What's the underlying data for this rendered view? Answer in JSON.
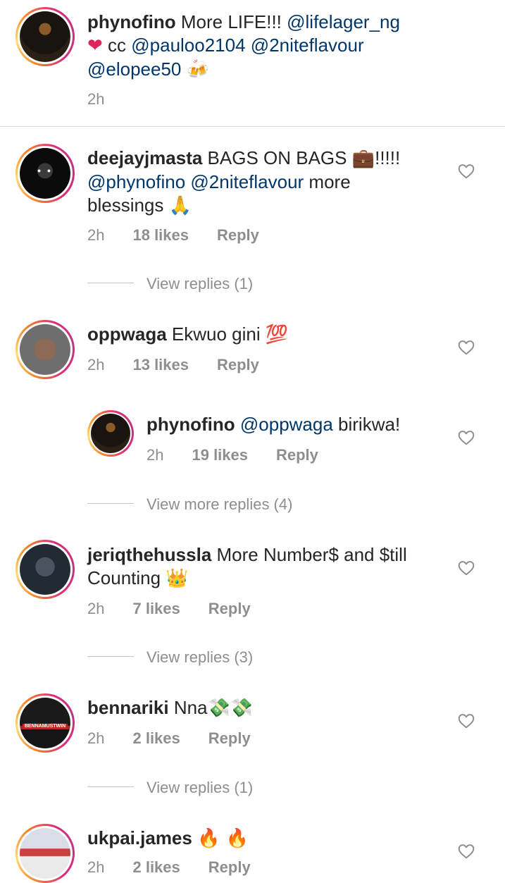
{
  "caption": {
    "username": "phynofino",
    "pre": " More LIFE!!! ",
    "m1": "@lifelager_ng",
    "heart": "❤",
    "cc": " cc ",
    "m2": "@pauloo2104",
    "m3": "@2niteflavour",
    "m4": "@elopee50",
    "emoji": "🍻",
    "time": "2h"
  },
  "comments": [
    {
      "username": "deejayjmasta",
      "text1": " BAGS ON BAGS ",
      "emoji1": "💼",
      "text2": "!!!!!",
      "m1": "@phynofino",
      "m2": "@2niteflavour",
      "text3": " more",
      "text4": "blessings ",
      "emoji2": "🙏",
      "time": "2h",
      "likes": "18 likes",
      "reply": "Reply",
      "view_replies": "View replies (1)"
    },
    {
      "username": "oppwaga",
      "text": " Ekwuo gini ",
      "emoji": "💯",
      "time": "2h",
      "likes": "13 likes",
      "reply": "Reply",
      "view_replies": "View more replies (4)",
      "reply_item": {
        "username": "phynofino",
        "mention": "@oppwaga",
        "text": " birikwa!",
        "time": "2h",
        "likes": "19 likes",
        "reply": "Reply"
      }
    },
    {
      "username": "jeriqthehussla",
      "text1": " More Number$ and $till",
      "text2": "Counting ",
      "emoji": "👑",
      "time": "2h",
      "likes": "7 likes",
      "reply": "Reply",
      "view_replies": "View replies (3)"
    },
    {
      "username": "bennariki",
      "text": " Nna",
      "emoji": "💸💸",
      "time": "2h",
      "likes": "2 likes",
      "reply": "Reply",
      "view_replies": "View replies (1)",
      "avatar_text": "BENNAMUSTWIN"
    },
    {
      "username": "ukpai.james",
      "text": " ",
      "emoji": "🔥 🔥",
      "time": "2h",
      "likes": "2 likes",
      "reply": "Reply"
    }
  ]
}
